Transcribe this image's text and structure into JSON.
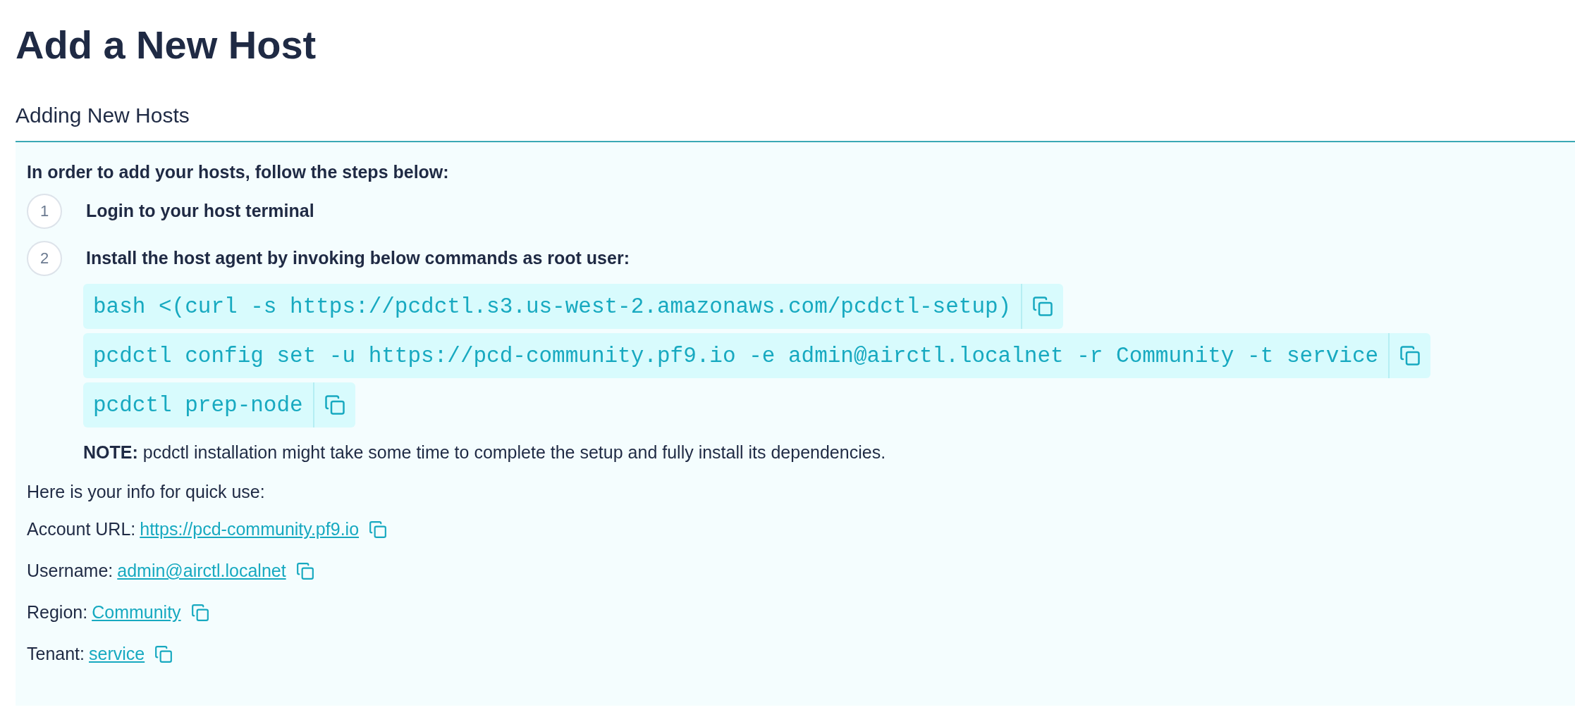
{
  "title": "Add a New Host",
  "section": {
    "title": "Adding New Hosts"
  },
  "intro": "In order to add your hosts, follow the steps below:",
  "steps": [
    {
      "number": "1",
      "text": "Login to your host terminal"
    },
    {
      "number": "2",
      "text": "Install the host agent by invoking below commands as root user:"
    }
  ],
  "commands": [
    "bash <(curl -s https://pcdctl.s3.us-west-2.amazonaws.com/pcdctl-setup)",
    "pcdctl config set -u https://pcd-community.pf9.io -e admin@airctl.localnet -r Community -t service",
    "pcdctl prep-node"
  ],
  "note": "**NOTE:** pcdctl installation might take some time to complete the setup and fully install its dependencies.",
  "info_heading": "Here is your info for quick use:",
  "info": [
    {
      "label": "Account URL:",
      "value": "https://pcd-community.pf9.io"
    },
    {
      "label": "Username:",
      "value": "admin@airctl.localnet"
    },
    {
      "label": "Region:",
      "value": "Community"
    },
    {
      "label": "Tenant:",
      "value": "service"
    }
  ]
}
